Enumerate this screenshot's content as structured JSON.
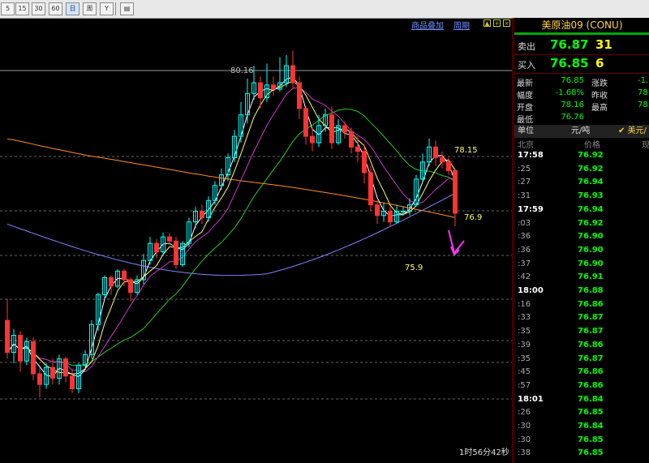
{
  "toolbar": {
    "buttons": [
      "5",
      "15",
      "30",
      "60",
      "日",
      "周",
      "Y",
      "▤"
    ]
  },
  "chart_header": {
    "overlay_link": "商品叠加",
    "gif_link": "周期"
  },
  "chart_labels": {
    "high_label": "80.16",
    "level_1": "78.15",
    "level_2": "76.9",
    "level_3": "75.9"
  },
  "timer": "1时56分42秒",
  "quote": {
    "title": "美原油09 (CONU)",
    "sell_label": "卖出",
    "sell_price": "76.87",
    "sell_vol": "31",
    "buy_label": "买入",
    "buy_price": "76.85",
    "buy_vol": "6",
    "stats": [
      {
        "l1": "最新",
        "v1": "76.85",
        "l2": "涨跌",
        "v2": "-1."
      },
      {
        "l1": "幅度",
        "v1": "-1.68%",
        "l2": "昨收",
        "v2": "78."
      },
      {
        "l1": "开盘",
        "v1": "78.16",
        "l2": "最高",
        "v2": "78."
      },
      {
        "l1": "最低",
        "v1": "76.76",
        "l2": "",
        "v2": ""
      }
    ],
    "unit_label": "单位",
    "unit_value": "元/吨",
    "currency": "美元/",
    "ticks_head": {
      "c1": "北京",
      "c2": "价格",
      "c3": "现"
    },
    "ticks": [
      {
        "t": "17:58",
        "p": "76.92"
      },
      {
        "t": ":25",
        "p": "76.92"
      },
      {
        "t": ":27",
        "p": "76.94"
      },
      {
        "t": ":31",
        "p": "76.93"
      },
      {
        "t": "17:59",
        "p": "76.94"
      },
      {
        "t": ":03",
        "p": "76.92"
      },
      {
        "t": ":36",
        "p": "76.90"
      },
      {
        "t": ":36",
        "p": "76.90"
      },
      {
        "t": ":37",
        "p": "76.90"
      },
      {
        "t": ":42",
        "p": "76.91"
      },
      {
        "t": "18:00",
        "p": "76.88"
      },
      {
        "t": ":16",
        "p": "76.86"
      },
      {
        "t": ":33",
        "p": "76.87"
      },
      {
        "t": ":35",
        "p": "76.87"
      },
      {
        "t": ":39",
        "p": "76.86"
      },
      {
        "t": ":35",
        "p": "76.87"
      },
      {
        "t": ":45",
        "p": "76.86"
      },
      {
        "t": ":57",
        "p": "76.86"
      },
      {
        "t": "18:01",
        "p": "76.84"
      },
      {
        "t": ":26",
        "p": "76.85"
      },
      {
        "t": ":30",
        "p": "76.84"
      },
      {
        "t": ":30",
        "p": "76.85"
      },
      {
        "t": ":38",
        "p": "76.85"
      }
    ]
  },
  "colors": {
    "up": "#00ffff",
    "down": "#ff3333",
    "ma5": "#ffffff",
    "ma10": "#ffff66",
    "ma20": "#cc33cc",
    "ma40": "#22cc22",
    "ma60": "#8080ff",
    "ma120": "#ff8c1a",
    "arrow": "#ff33ff"
  },
  "candles": [
    [
      79,
      77.5,
      80.0,
      77.2
    ],
    [
      77.5,
      78.3,
      78.6,
      77.0
    ],
    [
      78.3,
      77.1,
      78.5,
      76.6
    ],
    [
      77.1,
      78.0,
      78.2,
      76.9
    ],
    [
      78.0,
      76.5,
      78.2,
      76.2
    ],
    [
      76.5,
      76.0,
      76.8,
      75.4
    ],
    [
      76.0,
      76.8,
      77.0,
      75.8
    ],
    [
      76.8,
      76.3,
      77.2,
      76.0
    ],
    [
      76.3,
      77.2,
      77.4,
      76.0
    ],
    [
      77.2,
      76.4,
      77.3,
      76.1
    ],
    [
      76.4,
      75.8,
      76.7,
      75.6
    ],
    [
      75.8,
      76.9,
      77.0,
      75.6
    ],
    [
      76.9,
      77.4,
      77.6,
      76.7
    ],
    [
      77.4,
      78.8,
      79.0,
      77.2
    ],
    [
      78.8,
      80.2,
      80.3,
      78.5
    ],
    [
      80.2,
      81.0,
      81.1,
      80.0
    ],
    [
      81.0,
      80.6,
      81.1,
      80.2
    ],
    [
      80.6,
      81.3,
      81.4,
      80.5
    ],
    [
      81.3,
      80.9,
      81.4,
      80.6
    ],
    [
      80.9,
      80.3,
      81.0,
      79.9
    ],
    [
      80.3,
      80.9,
      81.1,
      80.2
    ],
    [
      80.9,
      81.8,
      82.1,
      80.7
    ],
    [
      81.8,
      82.6,
      82.9,
      81.6
    ],
    [
      82.6,
      82.2,
      82.8,
      81.9
    ],
    [
      82.2,
      82.9,
      83.1,
      82.0
    ],
    [
      82.9,
      82.7,
      83.1,
      82.5
    ],
    [
      82.7,
      81.6,
      82.9,
      81.4
    ],
    [
      81.6,
      82.6,
      82.7,
      81.5
    ],
    [
      82.6,
      83.6,
      83.8,
      82.4
    ],
    [
      83.6,
      84.1,
      84.3,
      83.3
    ],
    [
      84.1,
      83.8,
      84.4,
      83.5
    ],
    [
      83.8,
      84.6,
      84.8,
      83.6
    ],
    [
      84.6,
      85.3,
      85.5,
      84.4
    ],
    [
      85.3,
      85.8,
      86.1,
      85.1
    ],
    [
      85.8,
      86.6,
      86.8,
      85.5
    ],
    [
      86.6,
      87.6,
      87.9,
      86.4
    ],
    [
      87.6,
      88.6,
      89.2,
      87.3
    ],
    [
      88.6,
      89.6,
      90.3,
      88.2
    ],
    [
      89.6,
      90.1,
      90.9,
      89.3
    ],
    [
      90.1,
      89.4,
      90.4,
      88.9
    ],
    [
      89.4,
      90.0,
      91.0,
      89.2
    ],
    [
      90.0,
      89.8,
      90.4,
      89.5
    ],
    [
      89.8,
      90.1,
      91.3,
      89.7
    ],
    [
      90.1,
      90.9,
      91.4,
      89.9
    ],
    [
      90.9,
      90.1,
      91.6,
      89.8
    ],
    [
      90.1,
      88.9,
      90.4,
      88.4
    ],
    [
      88.9,
      87.6,
      89.0,
      87.2
    ],
    [
      87.6,
      87.3,
      88.0,
      86.9
    ],
    [
      87.3,
      88.1,
      88.6,
      87.1
    ],
    [
      88.1,
      88.6,
      88.9,
      87.8
    ],
    [
      88.6,
      87.3,
      89.0,
      87.0
    ],
    [
      87.3,
      88.1,
      88.4,
      87.2
    ],
    [
      88.1,
      87.8,
      88.3,
      87.5
    ],
    [
      87.8,
      87.1,
      88.0,
      86.8
    ],
    [
      87.1,
      86.9,
      87.6,
      86.4
    ],
    [
      86.9,
      85.9,
      87.2,
      85.4
    ],
    [
      85.9,
      84.4,
      86.2,
      84.1
    ],
    [
      84.4,
      83.9,
      84.6,
      83.5
    ],
    [
      83.9,
      84.1,
      84.5,
      83.6
    ],
    [
      84.1,
      83.6,
      84.3,
      83.4
    ],
    [
      83.6,
      84.1,
      84.4,
      83.5
    ],
    [
      84.1,
      84.1,
      84.3,
      83.9
    ],
    [
      84.1,
      84.4,
      84.7,
      83.9
    ],
    [
      84.4,
      85.6,
      85.8,
      84.3
    ],
    [
      85.6,
      86.4,
      86.8,
      85.5
    ],
    [
      86.4,
      87.1,
      87.5,
      86.2
    ],
    [
      87.1,
      86.6,
      87.4,
      86.2
    ],
    [
      86.6,
      86.4,
      86.9,
      86.1
    ],
    [
      86.4,
      86.0,
      86.6,
      85.8
    ],
    [
      86.0,
      84.0,
      86.1,
      83.4
    ]
  ]
}
